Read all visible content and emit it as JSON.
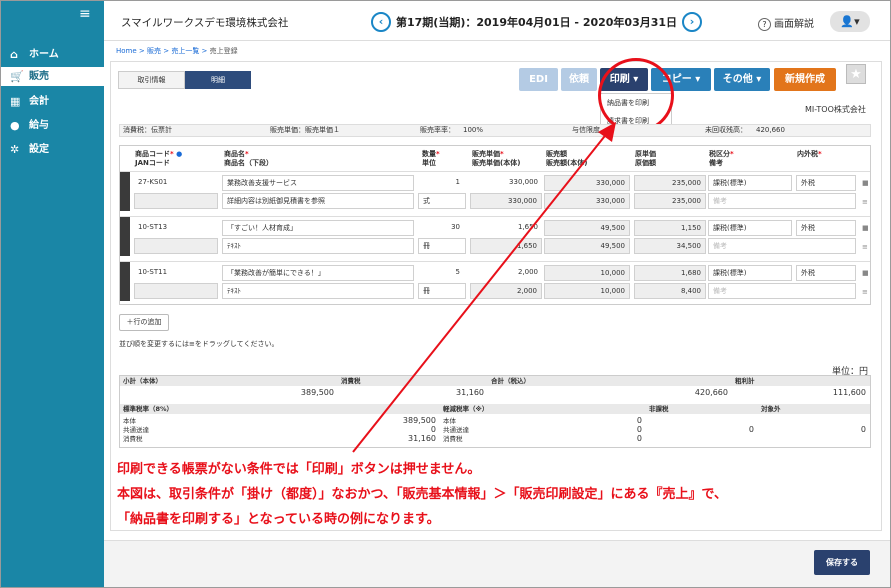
{
  "sidebar": {
    "items": [
      {
        "label": "ホーム",
        "icon": "home-icon"
      },
      {
        "label": "販売",
        "icon": "cart-icon"
      },
      {
        "label": "会計",
        "icon": "calculator-icon"
      },
      {
        "label": "給与",
        "icon": "money-bag-icon"
      },
      {
        "label": "設定",
        "icon": "gear-icon"
      }
    ]
  },
  "header": {
    "company": "スマイルワークスデモ環境株式会社",
    "period": "第17期(当期)：2019年04月01日 - 2020年03月31日",
    "help": "画面解説"
  },
  "breadcrumb": [
    "Home",
    "販売",
    "売上一覧",
    "売上登録"
  ],
  "tabs": [
    "取引情報",
    "明細"
  ],
  "toolbar": {
    "edi": "EDI",
    "irai": "依頼",
    "print": "印刷",
    "copy": "コピー",
    "other": "その他",
    "new": "新規作成"
  },
  "print_menu": [
    "納品書を印刷",
    "請求書を印刷"
  ],
  "partner": "MI-TOO株式会社",
  "info": {
    "tax_calc": "消費税：伝票計",
    "sales_price": "販売単価：販売単価１",
    "rate_label": "販売率率：",
    "rate": "100%",
    "limit_label": "与信限度",
    "balance_label": "未回収残高：",
    "balance": "420,660"
  },
  "table": {
    "headers": {
      "code": "商品コード",
      "jan": "JANコード",
      "name": "商品名",
      "name2": "商品名（下段）",
      "qty": "数量",
      "unit": "単位",
      "price": "販売単価",
      "price2": "販売単価(本体)",
      "amount": "販売額",
      "amount2": "販売額(本体)",
      "cost": "原単価",
      "cost2": "原価額",
      "taxclass": "税区分",
      "note": "備考",
      "inout": "内外税"
    },
    "rows": [
      {
        "code": "27-KS01",
        "name": "業務改善支援サービス",
        "qty": "1",
        "price": "330,000",
        "amount": "330,000",
        "cost": "235,000",
        "tax": "課税(標準)",
        "inout": "外税",
        "name2": "詳細内容は別紙御見積書を参照",
        "unit": "式",
        "price2": "330,000",
        "amount2": "330,000",
        "cost2": "235,000",
        "note": "備考"
      },
      {
        "code": "10-ST13",
        "name": "「すごい！人材育成」",
        "qty": "30",
        "price": "1,650",
        "amount": "49,500",
        "cost": "1,150",
        "tax": "課税(標準)",
        "inout": "外税",
        "name2": "ﾃｷｽﾄ",
        "unit": "冊",
        "price2": "1,650",
        "amount2": "49,500",
        "cost2": "34,500",
        "note": "備考"
      },
      {
        "code": "10-ST11",
        "name": "「業務改善が簡単にできる！」",
        "qty": "5",
        "price": "2,000",
        "amount": "10,000",
        "cost": "1,680",
        "tax": "課税(標準)",
        "inout": "外税",
        "name2": "ﾃｷｽﾄ",
        "unit": "冊",
        "price2": "2,000",
        "amount2": "10,000",
        "cost2": "8,400",
        "note": "備考"
      }
    ]
  },
  "add_row": "＋行の追加",
  "drag_note": "並び順を変更するには≡をドラッグしてください。",
  "unit_label": "単位：円",
  "summary": {
    "subtotal_label": "小計（本体）",
    "subtotal": "389,500",
    "tax_label": "消費税",
    "tax": "31,160",
    "total_label": "合計（税込）",
    "total": "420,660",
    "profit_label": "粗利計",
    "profit": "111,600",
    "std_label": "標準税率（8%）",
    "std_lines": [
      "本体",
      "共通送達",
      "消費税"
    ],
    "std_values": [
      "389,500",
      "0",
      "31,160"
    ],
    "reduced_label": "軽減税率（※）",
    "reduced_lines": [
      "本体",
      "共通送達",
      "消費税"
    ],
    "reduced_values": [
      "0",
      "0",
      "0"
    ],
    "nontax_label": "非課税",
    "nontax": "0",
    "exempt_label": "対象外",
    "exempt": "0"
  },
  "annotation": [
    "印刷できる帳票がない条件では「印刷」ボタンは押せません。",
    "本図は、取引条件が「掛け（都度）」なおかつ、「販売基本情報」＞「販売印刷設定」にある『売上』で、",
    "「納品書を印刷する」となっている時の例になります。"
  ],
  "save": "保存する",
  "colors": {
    "sidebar": "#1a86a6",
    "primary": "#2a416e",
    "accent": "#e2751b",
    "annotation": "#e8101a"
  }
}
